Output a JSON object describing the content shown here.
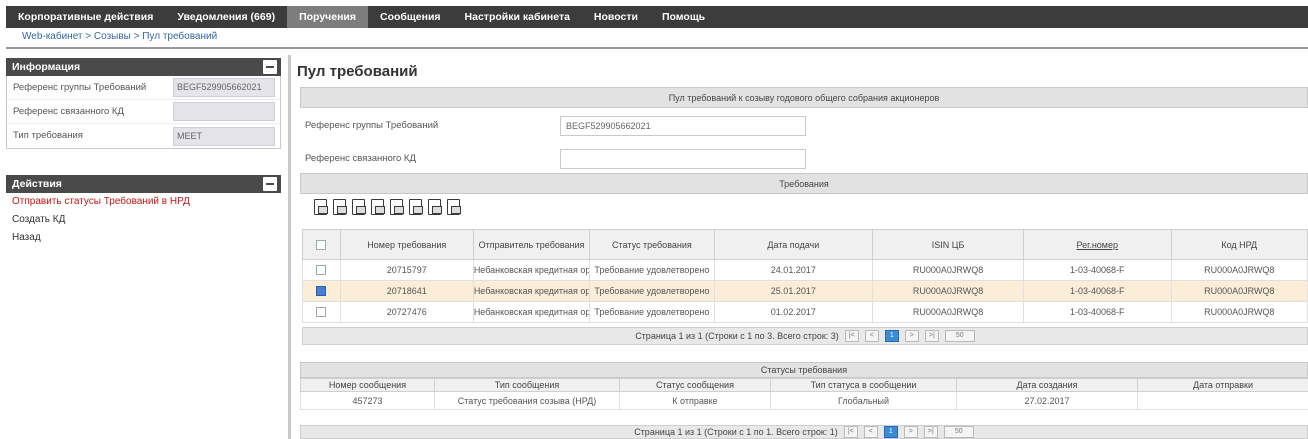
{
  "nav": {
    "items": [
      {
        "label": "Корпоративные действия",
        "active": false
      },
      {
        "label": "Уведомления (669)",
        "active": false
      },
      {
        "label": "Поручения",
        "active": true
      },
      {
        "label": "Сообщения",
        "active": false
      },
      {
        "label": "Настройки кабинета",
        "active": false
      },
      {
        "label": "Новости",
        "active": false
      },
      {
        "label": "Помощь",
        "active": false
      }
    ]
  },
  "breadcrumb": "Web-кабинет > Созывы > Пул требований",
  "info_panel": {
    "title": "Информация",
    "rows": [
      {
        "label": "Референс группы Требований",
        "value": "BEGF529905662021"
      },
      {
        "label": "Референс связанного КД",
        "value": ""
      },
      {
        "label": "Тип требования",
        "value": "MEET"
      }
    ]
  },
  "actions_panel": {
    "title": "Действия",
    "items": [
      {
        "label": "Отправить статусы Требований в НРД",
        "highlight": true
      },
      {
        "label": "Создать КД",
        "highlight": false
      },
      {
        "label": "Назад",
        "highlight": false
      }
    ]
  },
  "main": {
    "title": "Пул требований",
    "section_header": "Пул требований к созыву годового общего собрания акционеров",
    "group_ref_label": "Референс группы Требований",
    "group_ref_value": "BEGF529905662021",
    "kd_ref_label": "Референс связанного КД",
    "kd_ref_value": ""
  },
  "requirements": {
    "header": "Требования",
    "toolbar_icons": [
      "export-pdf-icon",
      "export-xls-icon",
      "export-csv-icon",
      "print-icon",
      "export-xml-icon",
      "export-doc-icon",
      "export-txt-icon",
      "export-rtf-icon"
    ],
    "columns": [
      "",
      "Номер требования",
      "Отправитель требования",
      "Статус требования",
      "Дата подачи",
      "ISIN ЦБ",
      "Рег.номер",
      "Код НРД"
    ],
    "rows": [
      {
        "checked": false,
        "selected": false,
        "cells": [
          "20715797",
          "Небанковская кредитная ор",
          "Требование удовлетворено",
          "24.01.2017",
          "RU000A0JRWQ8",
          "1-03-40068-F",
          "RU000A0JRWQ8"
        ]
      },
      {
        "checked": true,
        "selected": true,
        "cells": [
          "20718641",
          "Небанковская кредитная ор",
          "Требование удовлетворено",
          "25.01.2017",
          "RU000A0JRWQ8",
          "1-03-40068-F",
          "RU000A0JRWQ8"
        ]
      },
      {
        "checked": false,
        "selected": false,
        "cells": [
          "20727476",
          "Небанковская кредитная ор",
          "Требование удовлетворено",
          "01.02.2017",
          "RU000A0JRWQ8",
          "1-03-40068-F",
          "RU000A0JRWQ8"
        ]
      }
    ],
    "pager": {
      "text": "Страница 1 из 1 (Строки с 1 по 3. Всего строк: 3)",
      "page": "1",
      "page_size": "50"
    }
  },
  "statuses": {
    "header": "Статусы требования",
    "columns": [
      "Номер сообщения",
      "Тип сообщения",
      "Статус сообщения",
      "Тип статуса в сообщении",
      "Дата создания",
      "Дата отправки"
    ],
    "rows": [
      [
        "457273",
        "Статус требования созыва (НРД)",
        "К отправке",
        "Глобальный",
        "27.02.2017",
        ""
      ]
    ],
    "pager": {
      "text": "Страница 1 из 1 (Строки с 1 по 1. Всего строк: 1)",
      "page": "1",
      "page_size": "50"
    }
  }
}
